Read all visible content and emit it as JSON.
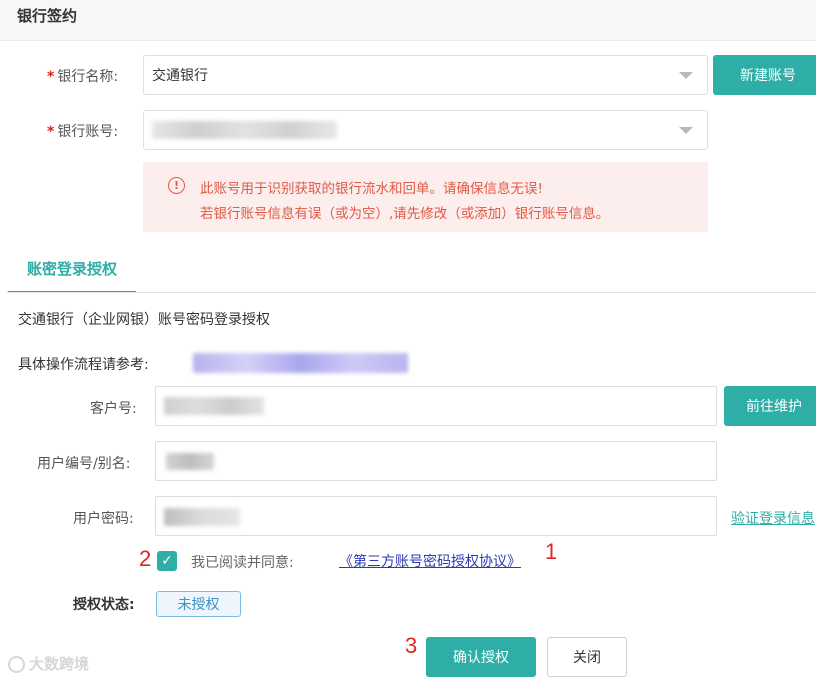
{
  "header": {
    "title": "银行签约"
  },
  "bank": {
    "name_label": "银行名称:",
    "name_value": "交通银行",
    "account_label": "银行账号:",
    "new_account_button": "新建账号"
  },
  "alert": {
    "line1": "此账号用于识别获取的银行流水和回单。请确保信息无误!",
    "line2": "若银行账号信息有误（或为空）,请先修改（或添加）银行账号信息。"
  },
  "tabs": [
    {
      "label": "账密登录授权"
    }
  ],
  "auth": {
    "description": "交通银行（企业网银）账号密码登录授权",
    "reference_label": "具体操作流程请参考:",
    "customer_no_label": "客户号:",
    "maintain_button": "前往维护",
    "user_id_label": "用户编号/别名:",
    "password_label": "用户密码:",
    "verify_link": "验证登录信息",
    "agree_label": "我已阅读并同意:",
    "agree_link": "《第三方账号密码授权协议》",
    "agree_checked": true,
    "status_label": "授权状态:",
    "status_value": "未授权"
  },
  "footer": {
    "confirm_button": "确认授权",
    "close_button": "关闭"
  },
  "markers": {
    "m1": "1",
    "m2": "2",
    "m3": "3"
  },
  "watermark": {
    "text": "大数跨境"
  },
  "colors": {
    "accent": "#2eaea7",
    "alert_text": "#e05a47",
    "required": "#e0201f",
    "link": "#2a3bb5"
  },
  "icons": {
    "alert": "exclamation-circle-icon",
    "dropdown": "chevron-down-icon",
    "check": "check-icon"
  }
}
